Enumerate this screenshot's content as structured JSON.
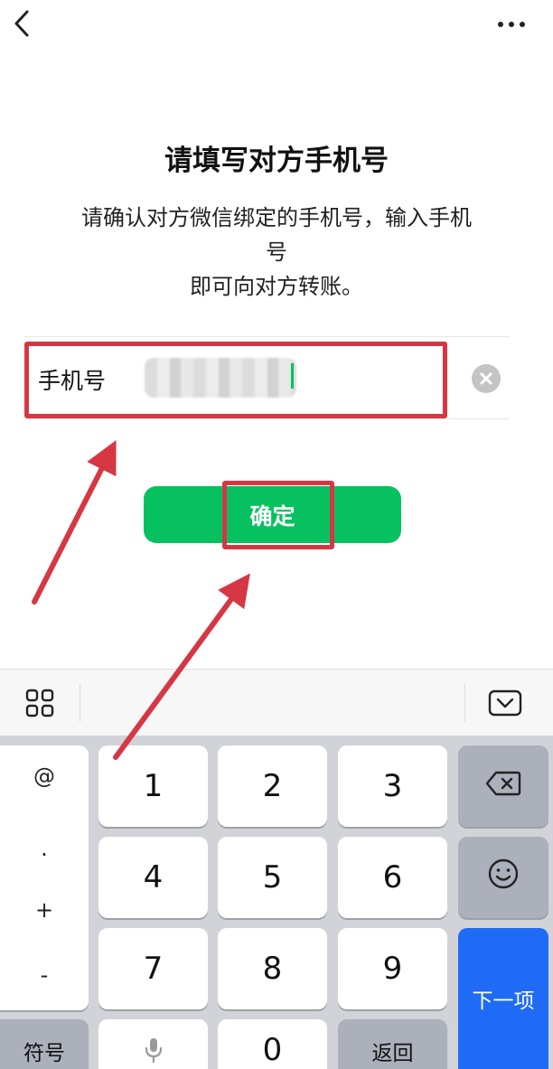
{
  "header": {
    "back_icon": "chevron-left-icon",
    "more_icon": "more-dots-icon"
  },
  "main": {
    "title": "请填写对方手机号",
    "desc_line1": "请确认对方微信绑定的手机号，输入手机号",
    "desc_line2": "即可向对方转账。",
    "phone_label": "手机号",
    "phone_value": "",
    "confirm_label": "确定"
  },
  "keyboard": {
    "symbols": [
      "@",
      ".",
      "+",
      "-"
    ],
    "digits": [
      "1",
      "2",
      "3",
      "4",
      "5",
      "6",
      "7",
      "8",
      "9",
      "0"
    ],
    "fuhao": "符号",
    "fanhui": "返回",
    "next": "下一项",
    "icons": [
      "grid-icon",
      "keyboard-hide-icon",
      "backspace-icon",
      "emoji-icon",
      "mic-icon"
    ]
  },
  "colors": {
    "accent": "#07c160",
    "annotation": "#d63744",
    "next_key": "#1f6bf5"
  }
}
